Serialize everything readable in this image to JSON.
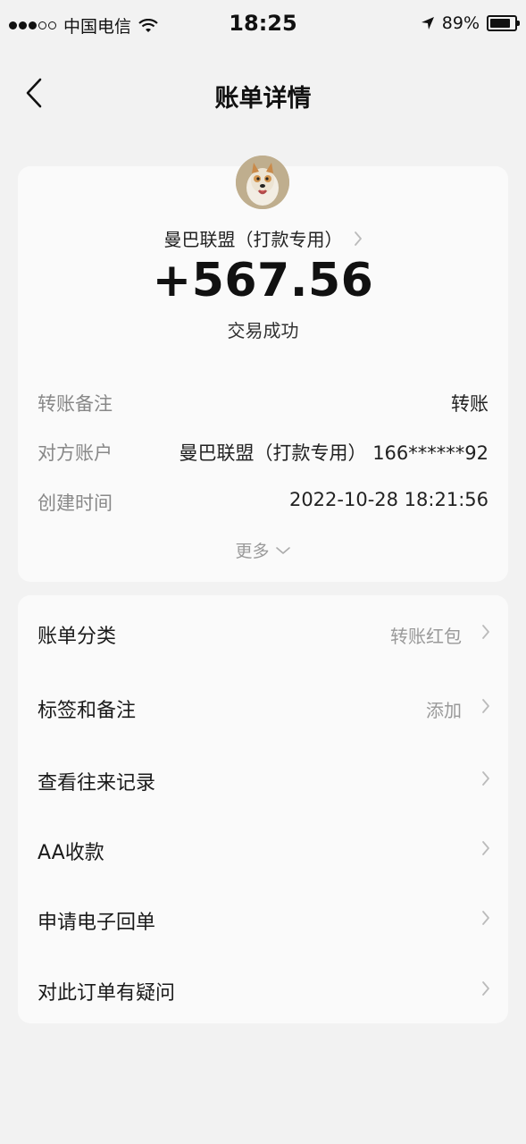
{
  "status_bar": {
    "carrier": "中国电信",
    "time": "18:25",
    "battery": "89%"
  },
  "nav": {
    "title": "账单详情"
  },
  "transaction": {
    "payee": "曼巴联盟（打款专用）",
    "amount": "+567.56",
    "status": "交易成功"
  },
  "details": [
    {
      "label": "转账备注",
      "value": "转账"
    },
    {
      "label": "对方账户",
      "value": "曼巴联盟（打款专用） 166******92"
    },
    {
      "label": "创建时间",
      "value": "2022-10-28 18:21:56"
    }
  ],
  "more_label": "更多",
  "menu": [
    {
      "label": "账单分类",
      "value": "转账红包"
    },
    {
      "label": "标签和备注",
      "value": "添加"
    },
    {
      "label": "查看往来记录",
      "value": ""
    },
    {
      "label": "AA收款",
      "value": ""
    },
    {
      "label": "申请电子回单",
      "value": ""
    },
    {
      "label": "对此订单有疑问",
      "value": ""
    }
  ],
  "icons": {
    "signal": "signal-dots-icon",
    "wifi": "wifi-icon",
    "location": "location-arrow-icon",
    "battery": "battery-icon",
    "back": "back-arrow-icon",
    "chevron": "chevron-right-icon",
    "more": "chevron-down-icon"
  }
}
